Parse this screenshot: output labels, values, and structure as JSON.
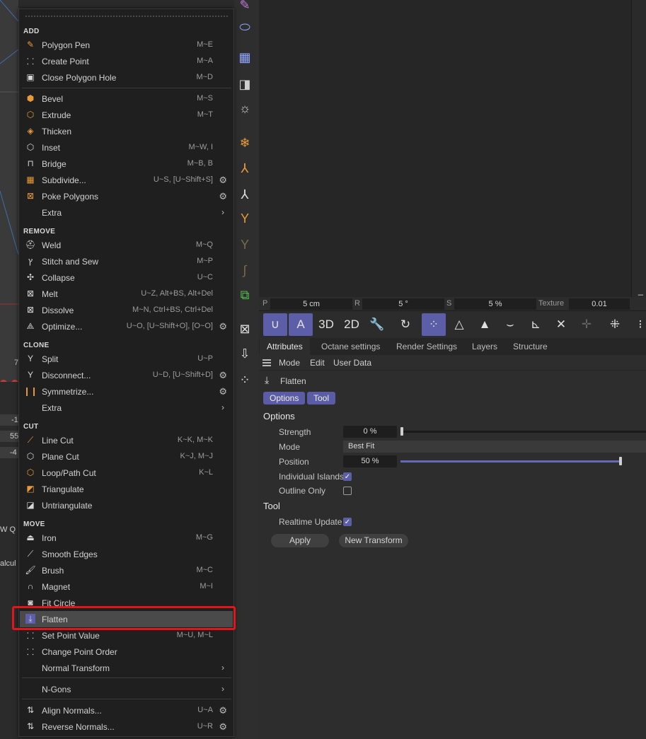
{
  "menu": {
    "sections": {
      "add": "ADD",
      "remove": "REMOVE",
      "clone": "CLONE",
      "cut": "CUT",
      "move": "MOVE"
    },
    "items": {
      "polygon_pen": {
        "label": "Polygon Pen",
        "shortcut": "M~E"
      },
      "create_point": {
        "label": "Create Point",
        "shortcut": "M~A"
      },
      "close_polygon_hole": {
        "label": "Close Polygon Hole",
        "shortcut": "M~D"
      },
      "bevel": {
        "label": "Bevel",
        "shortcut": "M~S"
      },
      "extrude": {
        "label": "Extrude",
        "shortcut": "M~T"
      },
      "thicken": {
        "label": "Thicken",
        "shortcut": ""
      },
      "inset": {
        "label": "Inset",
        "shortcut": "M~W, I"
      },
      "bridge": {
        "label": "Bridge",
        "shortcut": "M~B, B"
      },
      "subdivide": {
        "label": "Subdivide...",
        "shortcut": "U~S, [U~Shift+S]"
      },
      "poke_polygons": {
        "label": "Poke Polygons",
        "shortcut": ""
      },
      "extra_add": {
        "label": "Extra",
        "shortcut": ""
      },
      "weld": {
        "label": "Weld",
        "shortcut": "M~Q"
      },
      "stitch_sew": {
        "label": "Stitch and Sew",
        "shortcut": "M~P"
      },
      "collapse": {
        "label": "Collapse",
        "shortcut": "U~C"
      },
      "melt": {
        "label": "Melt",
        "shortcut": "U~Z, Alt+BS, Alt+Del"
      },
      "dissolve": {
        "label": "Dissolve",
        "shortcut": "M~N, Ctrl+BS, Ctrl+Del"
      },
      "optimize": {
        "label": "Optimize...",
        "shortcut": "U~O, [U~Shift+O], [O~O]"
      },
      "split": {
        "label": "Split",
        "shortcut": "U~P"
      },
      "disconnect": {
        "label": "Disconnect...",
        "shortcut": "U~D, [U~Shift+D]"
      },
      "symmetrize": {
        "label": "Symmetrize...",
        "shortcut": ""
      },
      "extra_clone": {
        "label": "Extra",
        "shortcut": ""
      },
      "line_cut": {
        "label": "Line Cut",
        "shortcut": "K~K, M~K"
      },
      "plane_cut": {
        "label": "Plane Cut",
        "shortcut": "K~J, M~J"
      },
      "loop_path_cut": {
        "label": "Loop/Path Cut",
        "shortcut": "K~L"
      },
      "triangulate": {
        "label": "Triangulate",
        "shortcut": ""
      },
      "untriangulate": {
        "label": "Untriangulate",
        "shortcut": ""
      },
      "iron": {
        "label": "Iron",
        "shortcut": "M~G"
      },
      "smooth_edges": {
        "label": "Smooth Edges",
        "shortcut": ""
      },
      "brush": {
        "label": "Brush",
        "shortcut": "M~C"
      },
      "magnet": {
        "label": "Magnet",
        "shortcut": "M~I"
      },
      "fit_circle": {
        "label": "Fit Circle",
        "shortcut": ""
      },
      "flatten": {
        "label": "Flatten",
        "shortcut": ""
      },
      "set_point_value": {
        "label": "Set Point Value",
        "shortcut": "M~U, M~L"
      },
      "change_point_order": {
        "label": "Change Point Order",
        "shortcut": ""
      },
      "normal_transform": {
        "label": "Normal Transform",
        "shortcut": ""
      },
      "ngons": {
        "label": "N-Gons",
        "shortcut": ""
      },
      "align_normals": {
        "label": "Align Normals...",
        "shortcut": "U~A"
      },
      "reverse_normals": {
        "label": "Reverse Normals...",
        "shortcut": "U~R"
      }
    }
  },
  "coord_bar": {
    "p_label": "P",
    "p_value": "5 cm",
    "r_label": "R",
    "r_value": "5 °",
    "s_label": "S",
    "s_value": "5 %",
    "texture_label": "Texture",
    "texture_value": "0.01"
  },
  "tool_strip": {
    "labels": {
      "three_d": "3D",
      "two_d": "2D",
      "a": "A"
    }
  },
  "attributes": {
    "tabs": [
      "Attributes",
      "Octane settings",
      "Render Settings",
      "Layers",
      "Structure"
    ],
    "menubar": {
      "mode": "Mode",
      "edit": "Edit",
      "user_data": "User Data"
    },
    "object_title": "Flatten",
    "pills": {
      "options": "Options",
      "tool": "Tool"
    },
    "options_section": "Options",
    "strength": {
      "label": "Strength",
      "value": "0 %",
      "fraction": 0.0
    },
    "mode": {
      "label": "Mode",
      "value": "Best Fit"
    },
    "position": {
      "label": "Position",
      "value": "50 %",
      "fraction": 1.0
    },
    "individual_islands": {
      "label": "Individual Islands",
      "checked": true
    },
    "outline_only": {
      "label": "Outline Only",
      "checked": false
    },
    "tool_section": "Tool",
    "realtime_update": {
      "label": "Realtime Update",
      "checked": true
    },
    "apply_button": "Apply",
    "new_transform_button": "New Transform"
  },
  "left_panel": {
    "v1": "-1",
    "v2": "55",
    "v3": "-4",
    "w_label": "W Q",
    "calc": "alcul",
    "seven": "7"
  },
  "colors": {
    "accent": "#5c5ea8",
    "highlight_box": "#e0161c",
    "icon_orange": "#e89a3a"
  }
}
